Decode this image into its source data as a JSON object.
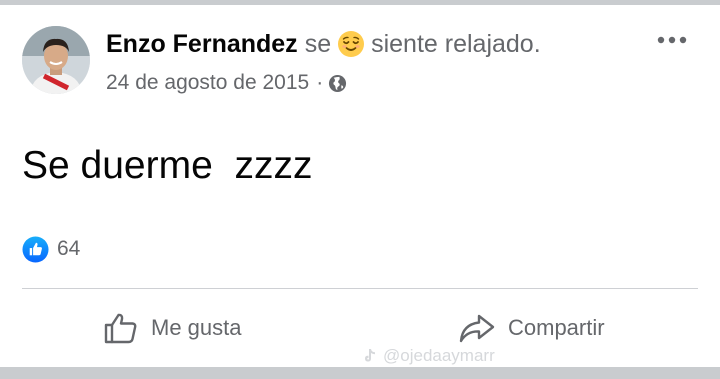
{
  "post": {
    "author": "Enzo Fernandez",
    "feeling_prefix": "se",
    "feeling_icon": "relieved-face-emoji",
    "feeling_text": "siente relajado.",
    "date": "24 de agosto de 2015",
    "separator": "·",
    "privacy_icon": "globe-icon",
    "text": "Se duerme  zzzz",
    "more_icon": "more-options-icon"
  },
  "reactions": {
    "icon": "like-reaction-icon",
    "count": "64"
  },
  "actions": {
    "like_label": "Me gusta",
    "like_icon": "thumbs-up-icon",
    "share_label": "Compartir",
    "share_icon": "share-arrow-icon"
  },
  "watermark": {
    "text": "@ojedaaymarr",
    "icon": "tiktok-logo"
  },
  "colors": {
    "text_primary": "#050505",
    "text_secondary": "#65676b",
    "like_blue": "#1877f2",
    "frame_gray": "#c9cccf",
    "emoji_yellow": "#ffcc4d"
  }
}
